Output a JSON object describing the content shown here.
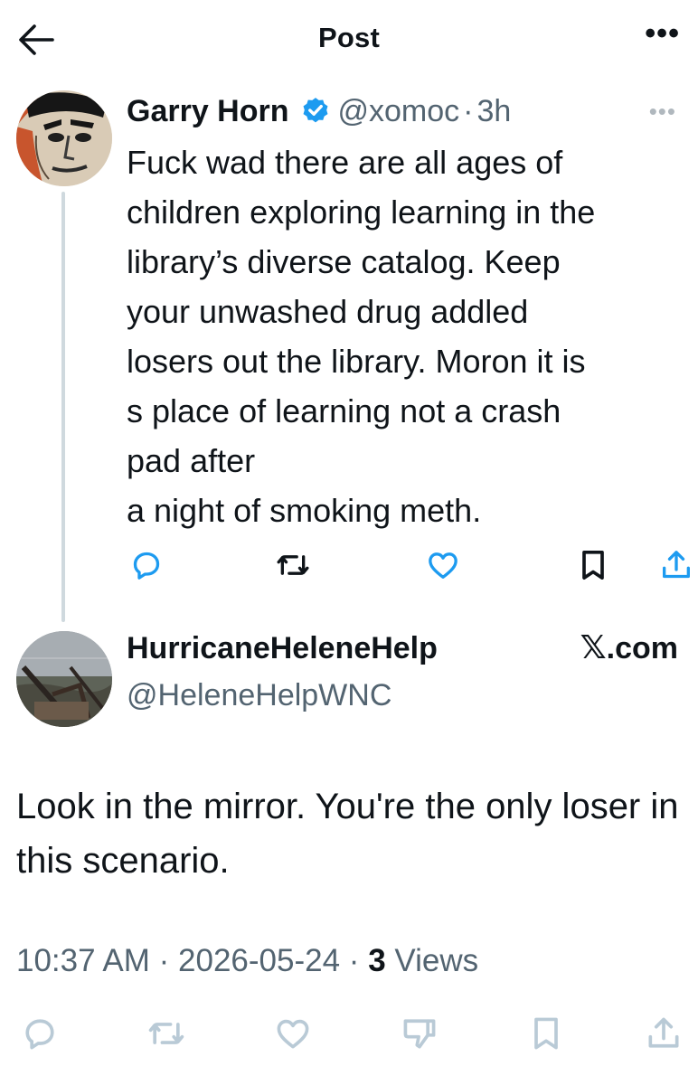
{
  "header": {
    "title": "Post",
    "more_label": "•••"
  },
  "parent_tweet": {
    "author_name": "Garry Horn",
    "handle": "@xomoc",
    "separator": "·",
    "time": "3h",
    "more_label": "•••",
    "text": "Fuck wad there are all ages of\nchildren exploring learning in the\nlibrary’s diverse catalog. Keep\nyour unwashed drug addled\nlosers out the library. Moron it is\ns place of learning not a crash\npad after\na night of smoking meth.",
    "actions": [
      "reply-icon",
      "retweet-icon",
      "like-icon",
      "bookmark-icon",
      "share-icon"
    ]
  },
  "reply_tweet": {
    "author_name": "HurricaneHeleneHelp",
    "handle": "@HeleneHelpWNC",
    "source_mark": "𝕏",
    "source_suffix": ".com",
    "text": "Look in the mirror. You're the only loser in this scenario.",
    "time": "10:37 AM",
    "separator": "·",
    "date": "2026-05-24",
    "views_count": "3",
    "views_label": "Views",
    "actions": [
      "reply-icon",
      "retweet-icon",
      "like-icon",
      "dislike-icon",
      "bookmark-icon",
      "share-icon"
    ]
  },
  "colors": {
    "text_primary": "#0f1419",
    "text_secondary": "#536471",
    "verified_blue": "#1d9bf0",
    "thread_line": "#cfd9de",
    "icon_muted": "#b9cad6"
  }
}
